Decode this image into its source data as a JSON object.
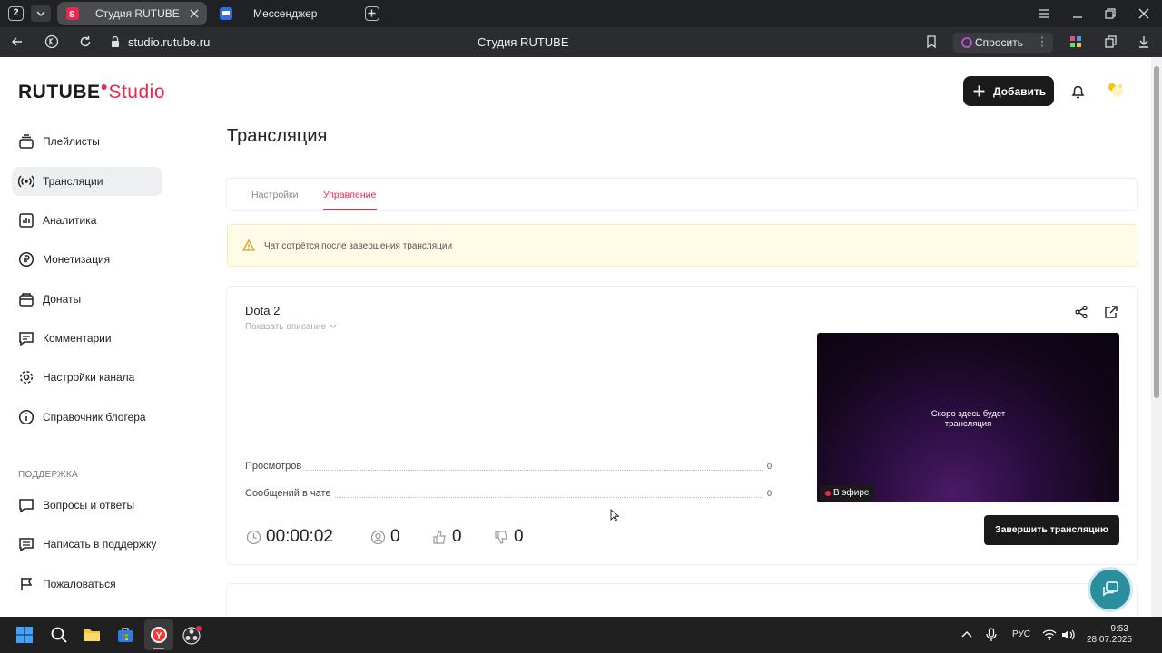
{
  "browser": {
    "tab_count": "2",
    "tabs": [
      {
        "title": "Студия RUTUBE",
        "active": true
      },
      {
        "title": "Мессенджер",
        "active": false
      }
    ],
    "address": "studio.rutube.ru",
    "page_title": "Студия RUTUBE",
    "ask_label": "Спросить"
  },
  "header": {
    "logo_rutube": "RUTUBE",
    "logo_studio": "Studio",
    "add_button": "Добавить"
  },
  "sidebar": {
    "items": [
      {
        "label": "Плейлисты",
        "icon": "playlist-icon"
      },
      {
        "label": "Трансляции",
        "icon": "broadcast-icon",
        "active": true
      },
      {
        "label": "Аналитика",
        "icon": "analytics-icon"
      },
      {
        "label": "Монетизация",
        "icon": "ruble-icon"
      },
      {
        "label": "Донаты",
        "icon": "donate-icon"
      },
      {
        "label": "Комментарии",
        "icon": "comments-icon"
      },
      {
        "label": "Настройки канала",
        "icon": "gear-icon"
      },
      {
        "label": "Справочник блогера",
        "icon": "info-icon"
      }
    ],
    "support_title": "ПОДДЕРЖКА",
    "support_items": [
      {
        "label": "Вопросы и ответы",
        "icon": "faq-icon"
      },
      {
        "label": "Написать в поддержку",
        "icon": "mail-icon"
      },
      {
        "label": "Пожаловаться",
        "icon": "flag-icon"
      }
    ]
  },
  "main": {
    "title": "Трансляция",
    "tabs": [
      {
        "label": "Настройки",
        "active": false
      },
      {
        "label": "Управление",
        "active": true
      }
    ],
    "alert": "Чат сотрётся после завершения трансляции",
    "stream": {
      "title": "Dota 2",
      "show_description": "Показать описание",
      "stats": [
        {
          "label": "Просмотров",
          "value": "0"
        },
        {
          "label": "Сообщений в чате",
          "value": "0"
        }
      ],
      "preview_line1": "Скоро здесь будет",
      "preview_line2": "трансляция",
      "live_badge": "В эфире",
      "duration": "00:00:02",
      "viewers": "0",
      "likes": "0",
      "dislikes": "0",
      "end_button": "Завершить трансляцию"
    }
  },
  "taskbar": {
    "lang": "РУС",
    "time": "9:53",
    "date": "28.07.2025"
  },
  "colors": {
    "accent": "#e8284c",
    "dark": "#1a1a1a",
    "alert_bg": "#fffbe6",
    "help_fab": "#2a8e9e"
  }
}
